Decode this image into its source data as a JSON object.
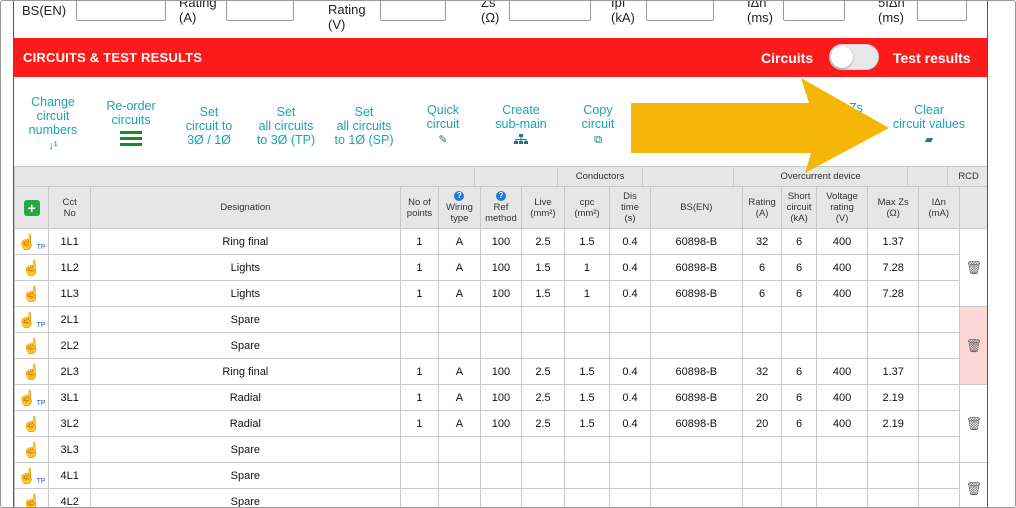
{
  "top_fields": [
    {
      "label": "BS(EN)"
    },
    {
      "label": "Rating\n(A)"
    },
    {
      "label": "Rating\n(V)"
    },
    {
      "label": "Zs\n(Ω)"
    },
    {
      "label": "Ipf\n(kA)"
    },
    {
      "label": "IΔn\n(ms)"
    },
    {
      "label": "5IΔn\n(ms)"
    }
  ],
  "header": {
    "title": "CIRCUITS & TEST RESULTS",
    "toggle_left": "Circuits",
    "toggle_right": "Test results",
    "toggle_on": false,
    "bg_color": "#ff1a1a"
  },
  "toolbar": {
    "change_numbers": "Change\ncircuit\nnumbers",
    "change_numbers_icon": "sort-numeric-icon",
    "reorder": "Re-order\ncircuits",
    "reorder_icon": "menu-bars-icon",
    "set_3to1": "Set\ncircuit to\n3Ø / 1Ø",
    "set_all_tp": "Set\nall circuits\nto 3Ø (TP)",
    "set_all_sp": "Set\nall circuits\nto 1Ø (SP)",
    "quick": "Quick\ncircuit",
    "quick_icon": "magic-wand-icon",
    "create_sub": "Create\nsub-main",
    "create_sub_icon": "sitemap-icon",
    "copy": "Copy\ncircuit",
    "copy_icon": "copy-icon",
    "partial_zs": "Zs",
    "clear": "Clear\ncircuit values",
    "clear_icon": "eraser-icon"
  },
  "table": {
    "groups": {
      "conductors": "Conductors",
      "overcurrent": "Overcurrent device",
      "rcd": "RCD"
    },
    "columns": {
      "cct_no": "Cct\nNo",
      "designation": "Designation",
      "no_points": "No of\npoints",
      "wiring": "Wiring\ntype",
      "ref": "Ref\nmethod",
      "live": "Live\n(mm²)",
      "cpc": "cpc\n(mm²)",
      "dis_time": "Dis\ntime\n(s)",
      "bsen": "BS(EN)",
      "rating": "Rating\n(A)",
      "short": "Short\ncircuit\n(kA)",
      "voltage": "Voltage\nrating\n(V)",
      "maxzs": "Max Zs\n(Ω)",
      "idn": "IΔn\n(mA)"
    },
    "rows": [
      {
        "cct": "1L1",
        "tp": "TP",
        "des": "Ring final",
        "points": "1",
        "wiring": "A",
        "ref": "100",
        "live": "2.5",
        "cpc": "1.5",
        "dis": "0.4",
        "bsen": "60898-B",
        "rating": "32",
        "short": "6",
        "volt": "400",
        "maxzs": "1.37",
        "idn": ""
      },
      {
        "cct": "1L2",
        "tp": "",
        "des": "Lights",
        "points": "1",
        "wiring": "A",
        "ref": "100",
        "live": "1.5",
        "cpc": "1",
        "dis": "0.4",
        "bsen": "60898-B",
        "rating": "6",
        "short": "6",
        "volt": "400",
        "maxzs": "7.28",
        "idn": ""
      },
      {
        "cct": "1L3",
        "tp": "",
        "des": "Lights",
        "points": "1",
        "wiring": "A",
        "ref": "100",
        "live": "1.5",
        "cpc": "1",
        "dis": "0.4",
        "bsen": "60898-B",
        "rating": "6",
        "short": "6",
        "volt": "400",
        "maxzs": "7.28",
        "idn": ""
      },
      {
        "cct": "2L1",
        "tp": "TP",
        "des": "Spare",
        "points": "",
        "wiring": "",
        "ref": "",
        "live": "",
        "cpc": "",
        "dis": "",
        "bsen": "",
        "rating": "",
        "short": "",
        "volt": "",
        "maxzs": "",
        "idn": ""
      },
      {
        "cct": "2L2",
        "tp": "",
        "des": "Spare",
        "points": "",
        "wiring": "",
        "ref": "",
        "live": "",
        "cpc": "",
        "dis": "",
        "bsen": "",
        "rating": "",
        "short": "",
        "volt": "",
        "maxzs": "",
        "idn": ""
      },
      {
        "cct": "2L3",
        "tp": "",
        "des": "Ring final",
        "points": "1",
        "wiring": "A",
        "ref": "100",
        "live": "2.5",
        "cpc": "1.5",
        "dis": "0.4",
        "bsen": "60898-B",
        "rating": "32",
        "short": "6",
        "volt": "400",
        "maxzs": "1.37",
        "idn": ""
      },
      {
        "cct": "3L1",
        "tp": "TP",
        "des": "Radial",
        "points": "1",
        "wiring": "A",
        "ref": "100",
        "live": "2.5",
        "cpc": "1.5",
        "dis": "0.4",
        "bsen": "60898-B",
        "rating": "20",
        "short": "6",
        "volt": "400",
        "maxzs": "2.19",
        "idn": ""
      },
      {
        "cct": "3L2",
        "tp": "",
        "des": "Radial",
        "points": "1",
        "wiring": "A",
        "ref": "100",
        "live": "2.5",
        "cpc": "1.5",
        "dis": "0.4",
        "bsen": "60898-B",
        "rating": "20",
        "short": "6",
        "volt": "400",
        "maxzs": "2.19",
        "idn": ""
      },
      {
        "cct": "3L3",
        "tp": "",
        "des": "Spare",
        "points": "",
        "wiring": "",
        "ref": "",
        "live": "",
        "cpc": "",
        "dis": "",
        "bsen": "",
        "rating": "",
        "short": "",
        "volt": "",
        "maxzs": "",
        "idn": ""
      },
      {
        "cct": "4L1",
        "tp": "TP",
        "des": "Spare",
        "points": "",
        "wiring": "",
        "ref": "",
        "live": "",
        "cpc": "",
        "dis": "",
        "bsen": "",
        "rating": "",
        "short": "",
        "volt": "",
        "maxzs": "",
        "idn": ""
      },
      {
        "cct": "4L2",
        "tp": "",
        "des": "Spare",
        "points": "",
        "wiring": "",
        "ref": "",
        "live": "",
        "cpc": "",
        "dis": "",
        "bsen": "",
        "rating": "",
        "short": "",
        "volt": "",
        "maxzs": "",
        "idn": ""
      }
    ]
  },
  "colors": {
    "accent_teal": "#1aa3b5",
    "arrow": "#f5b400",
    "pink_row": "#ffd6d6"
  }
}
